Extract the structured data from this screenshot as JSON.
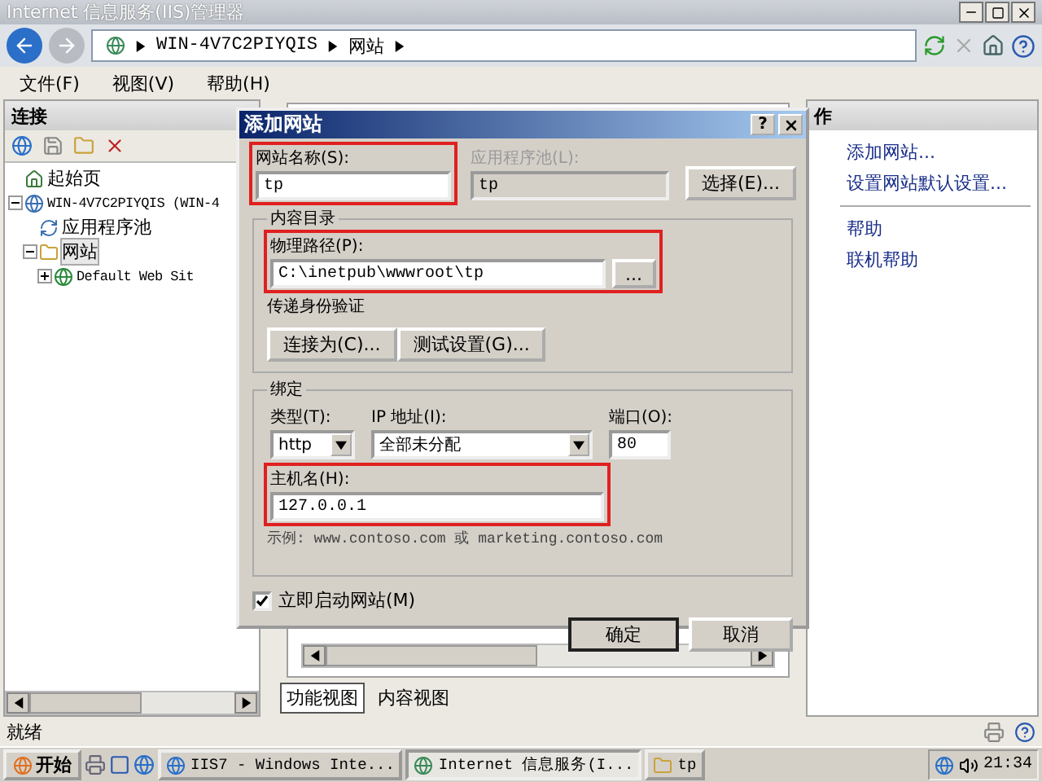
{
  "window": {
    "title": "Internet 信息服务(IIS)管理器"
  },
  "address": {
    "segments": [
      "WIN-4V7C2PIYQIS",
      "网站"
    ]
  },
  "menu": [
    "文件(F)",
    "视图(V)",
    "帮助(H)"
  ],
  "connections": {
    "title": "连接",
    "tree": [
      {
        "label": "起始页",
        "kind": "start",
        "selected": false
      },
      {
        "label": "WIN-4V7C2PIYQIS (WIN-4",
        "kind": "server",
        "expanded": true,
        "selected": false,
        "children": [
          {
            "label": "应用程序池",
            "kind": "pool",
            "selected": false
          },
          {
            "label": "网站",
            "kind": "sites",
            "expanded": true,
            "selected": true,
            "children": [
              {
                "label": "Default Web Sit",
                "kind": "site",
                "expanded": false,
                "selected": false
              }
            ]
          }
        ]
      }
    ]
  },
  "actions": {
    "title": "作",
    "groups": [
      [
        "添加网站...",
        "设置网站默认设置..."
      ],
      [
        "帮助",
        "联机帮助"
      ]
    ]
  },
  "views": [
    {
      "label": "功能视图",
      "selected": true
    },
    {
      "label": "内容视图",
      "selected": false
    }
  ],
  "status_bar": {
    "text": "就绪"
  },
  "taskbar": {
    "start": "开始",
    "tasks": [
      {
        "label": "IIS7 - Windows Inte...",
        "kind": "browser",
        "selected": false
      },
      {
        "label": "Internet 信息服务(I...",
        "kind": "iis",
        "selected": true
      },
      {
        "label": "tp",
        "kind": "folder",
        "selected": false
      }
    ],
    "clock": "21:34"
  },
  "dialog": {
    "title": "添加网站",
    "help": "?",
    "site_name": {
      "label": "网站名称(S):",
      "value": "tp",
      "highlighted": true
    },
    "app_pool": {
      "label": "应用程序池(L):",
      "value": "tp",
      "disabled": true
    },
    "select_button": "选择(E)...",
    "content": {
      "title": "内容目录",
      "path": {
        "label": "物理路径(P):",
        "value": "C:\\inetpub\\wwwroot\\tp",
        "highlighted": true
      },
      "browse_button": "...",
      "auth_label": "传递身份验证",
      "buttons": [
        "连接为(C)...",
        "测试设置(G)..."
      ]
    },
    "binding": {
      "title": "绑定",
      "type": {
        "label": "类型(T):",
        "value": "http"
      },
      "ip": {
        "label": "IP 地址(I):",
        "value": "全部未分配"
      },
      "port": {
        "label": "端口(O):",
        "value": "80"
      },
      "host": {
        "label": "主机名(H):",
        "value": "127.0.0.1",
        "highlighted": true
      },
      "example": "示例: www.contoso.com 或 marketing.contoso.com"
    },
    "start_now": {
      "label": "立即启动网站(M)",
      "checked": true
    },
    "ok": "确定",
    "cancel": "取消"
  }
}
